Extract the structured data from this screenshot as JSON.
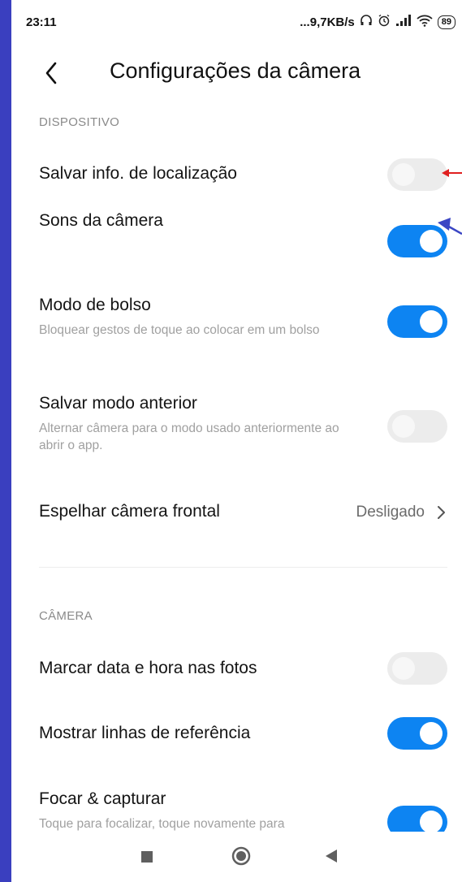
{
  "status_bar": {
    "time": "23:11",
    "network_speed": "...9,7KB/s",
    "battery": "89",
    "icons": [
      "headset-icon",
      "alarm-icon",
      "signal-icon",
      "wifi-icon",
      "battery-icon"
    ]
  },
  "header": {
    "back_icon": "chevron-left-icon",
    "title": "Configurações da câmera"
  },
  "sections": [
    {
      "label": "DISPOSITIVO",
      "items": [
        {
          "label": "Salvar info. de localização",
          "toggle": false
        },
        {
          "label": "Sons da câmera",
          "toggle": true
        },
        {
          "label": "Modo de bolso",
          "sublabel": "Bloquear gestos de toque ao colocar em um bolso",
          "toggle": true
        },
        {
          "label": "Salvar modo anterior",
          "sublabel": "Alternar câmera para o modo usado anteriormente ao abrir o app.",
          "toggle": false
        },
        {
          "label": "Espelhar câmera frontal",
          "value": "Desligado"
        }
      ]
    },
    {
      "label": "CÂMERA",
      "items": [
        {
          "label": "Marcar data e hora nas fotos",
          "toggle": false
        },
        {
          "label": "Mostrar linhas de referência",
          "toggle": true
        },
        {
          "label": "Focar & capturar",
          "sublabel": "Toque para focalizar, toque novamente para",
          "toggle": true
        }
      ]
    }
  ],
  "annotations": {
    "red_arrow_color": "#e02020",
    "blue_arrow_color": "#3b46c4"
  },
  "colors": {
    "toggle_on": "#0d84f2",
    "toggle_off": "#ececec",
    "frame": "#3a3fbf"
  },
  "nav_bar": {
    "icons": [
      "recents-square-icon",
      "home-circle-icon",
      "back-triangle-icon"
    ]
  }
}
